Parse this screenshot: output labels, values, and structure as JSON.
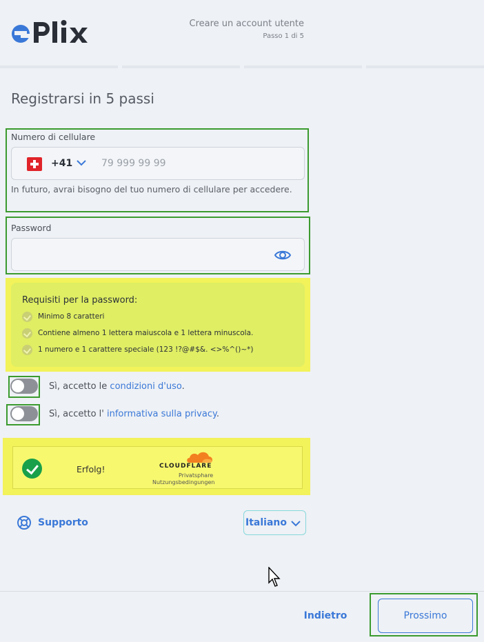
{
  "header": {
    "brand": "ePlix",
    "step_title": "Creare un account utente",
    "step_counter": "Passo 1 di 5",
    "progress_segments": 4
  },
  "page_title": "Registrarsi in 5 passi",
  "phone": {
    "label": "Numero di cellulare",
    "country_flag": "swiss-flag-icon",
    "dial_code": "+41",
    "placeholder": "79 999 99 99",
    "value": "",
    "hint": "In futuro, avrai bisogno del tuo numero di cellulare per accedere."
  },
  "password": {
    "label": "Password",
    "value": "",
    "toggle_icon": "eye-icon"
  },
  "requirements": {
    "title": "Requisiti per la password:",
    "items": [
      "Minimo 8 caratteri",
      "Contiene almeno 1 lettera maiuscola e 1 lettera minuscola.",
      "1 numero e 1 carattere speciale (123 !?@#$&. <>%^()~*)"
    ]
  },
  "consents": [
    {
      "prefix": "Sì, accetto le ",
      "link": "condizioni d'uso",
      "suffix": ".",
      "checked": false
    },
    {
      "prefix": "Sì, accetto l' ",
      "link": "informativa sulla privacy",
      "suffix": ".",
      "checked": false
    }
  ],
  "captcha": {
    "status": "Erfolg!",
    "brand": "CLOUDFLARE",
    "privacy_link": "Privatsphare",
    "terms_link": "Nutzungsbedingungen"
  },
  "support": {
    "label": "Supporto",
    "icon": "lifebuoy-icon"
  },
  "language": {
    "selected": "Italiano"
  },
  "footer": {
    "back_label": "Indietro",
    "next_label": "Prossimo"
  },
  "colors": {
    "accent": "#3a78d8",
    "background": "#eef1f5",
    "highlight_green": "#3a9a2e",
    "highlight_yellow": "#f2f25a",
    "requirements_bg": "#dfee63",
    "success": "#1aa04a",
    "cloudflare_orange": "#f38020"
  }
}
